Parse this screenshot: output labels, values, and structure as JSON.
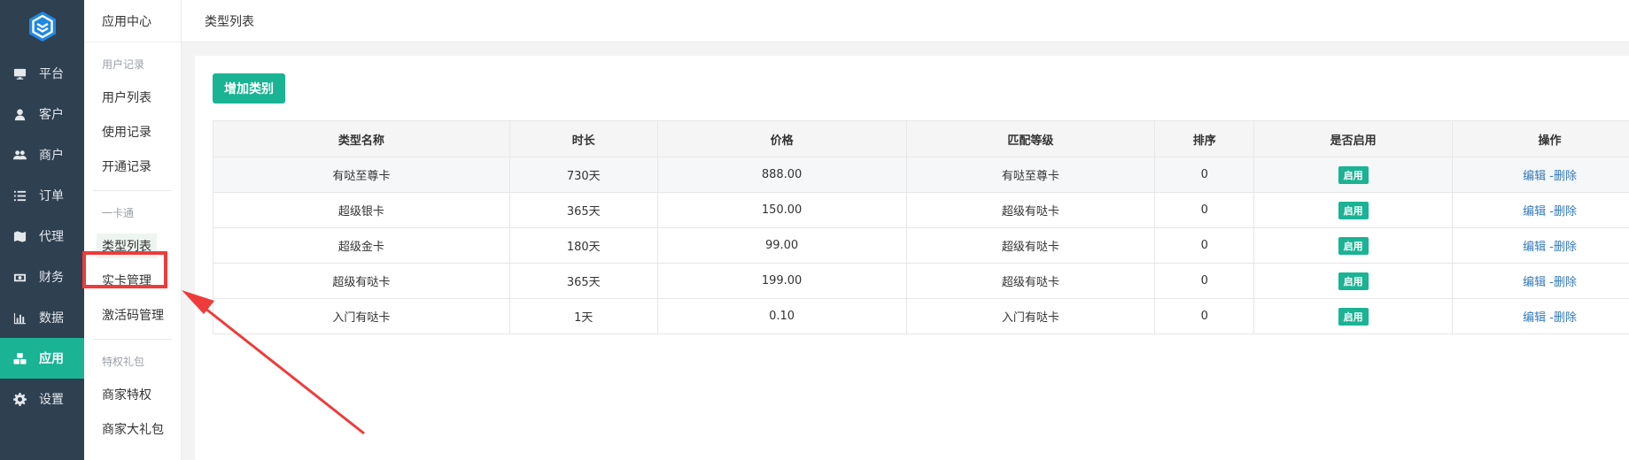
{
  "sidebar": {
    "items": [
      {
        "label": "平台",
        "icon": "monitor-icon"
      },
      {
        "label": "客户",
        "icon": "user-icon"
      },
      {
        "label": "商户",
        "icon": "users-icon"
      },
      {
        "label": "订单",
        "icon": "list-icon"
      },
      {
        "label": "代理",
        "icon": "map-icon"
      },
      {
        "label": "财务",
        "icon": "money-icon"
      },
      {
        "label": "数据",
        "icon": "bar-chart-icon"
      },
      {
        "label": "应用",
        "icon": "cubes-icon",
        "active": true
      },
      {
        "label": "设置",
        "icon": "gear-icon"
      }
    ]
  },
  "subnav": {
    "header": "应用中心",
    "groups": [
      {
        "title": "用户记录",
        "items": [
          "用户列表",
          "使用记录",
          "开通记录"
        ]
      },
      {
        "title": "一卡通",
        "items": [
          "类型列表",
          "实卡管理",
          "激活码管理"
        ]
      },
      {
        "title": "特权礼包",
        "items": [
          "商家特权",
          "商家大礼包"
        ]
      }
    ],
    "selected": "类型列表"
  },
  "breadcrumb": {
    "current": "类型列表"
  },
  "toolbar": {
    "add_label": "增加类别"
  },
  "table": {
    "columns": [
      "类型名称",
      "时长",
      "价格",
      "匹配等级",
      "排序",
      "是否启用",
      "操作"
    ],
    "rows": [
      {
        "name": "有哒至尊卡",
        "duration": "730天",
        "price": "888.00",
        "level": "有哒至尊卡",
        "sort": "0",
        "status": "启用"
      },
      {
        "name": "超级银卡",
        "duration": "365天",
        "price": "150.00",
        "level": "超级有哒卡",
        "sort": "0",
        "status": "启用"
      },
      {
        "name": "超级金卡",
        "duration": "180天",
        "price": "99.00",
        "level": "超级有哒卡",
        "sort": "0",
        "status": "启用"
      },
      {
        "name": "超级有哒卡",
        "duration": "365天",
        "price": "199.00",
        "level": "超级有哒卡",
        "sort": "0",
        "status": "启用"
      },
      {
        "name": "入门有哒卡",
        "duration": "1天",
        "price": "0.10",
        "level": "入门有哒卡",
        "sort": "0",
        "status": "启用"
      }
    ],
    "actions": {
      "edit": "编辑",
      "separator": " -",
      "delete": "删除"
    }
  },
  "colors": {
    "sidebar_bg": "#2f4050",
    "accent": "#1ab394",
    "link": "#337ab7",
    "annotation": "#ef3b3b"
  }
}
